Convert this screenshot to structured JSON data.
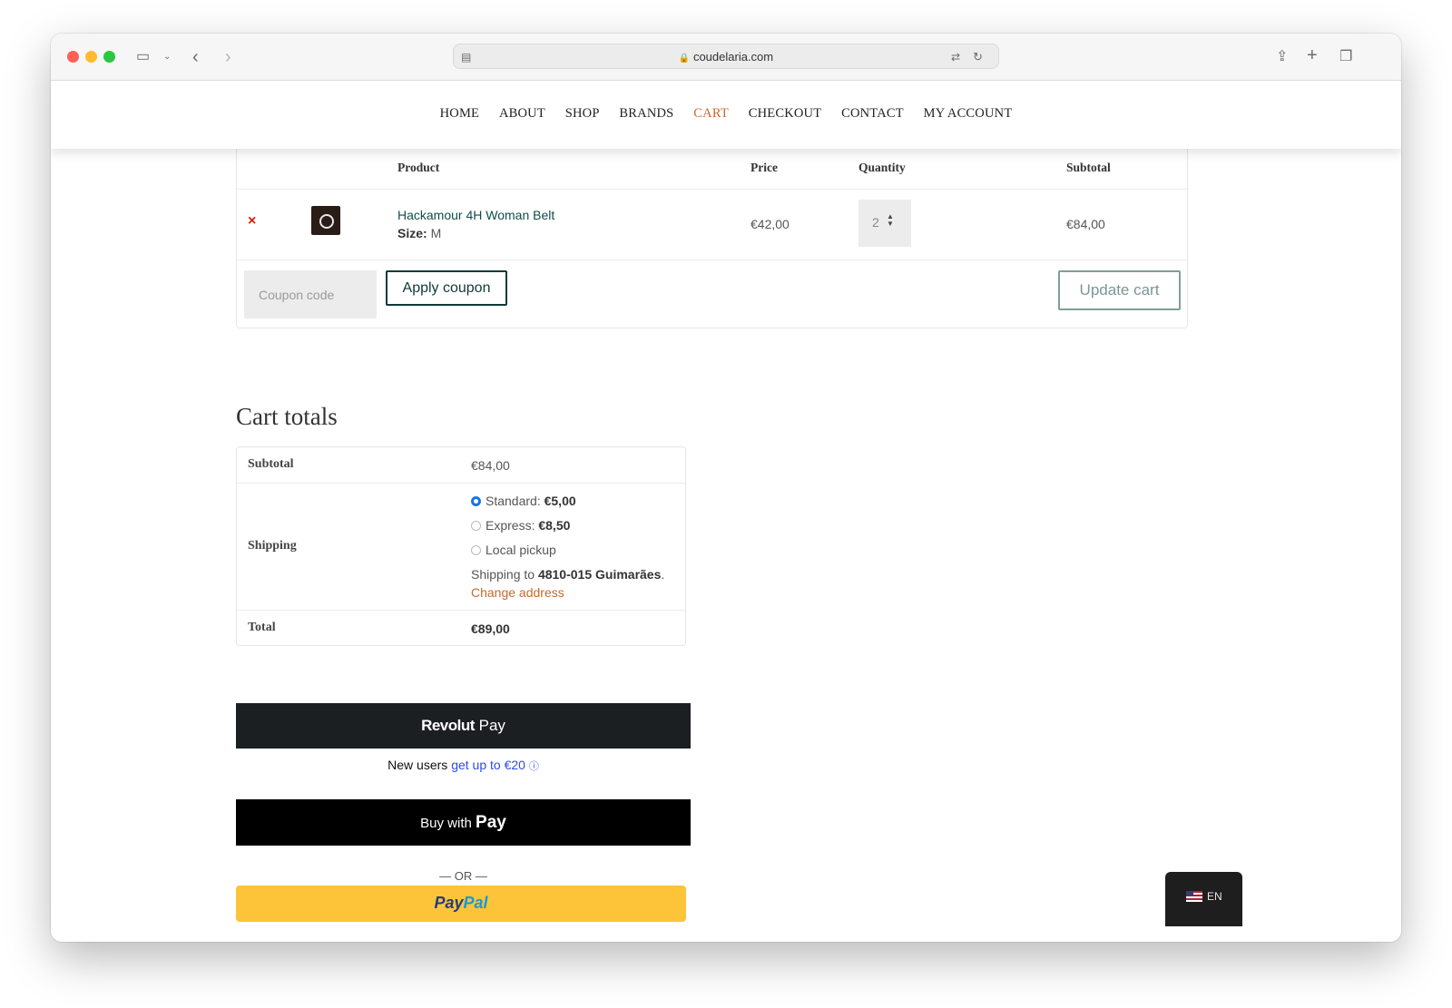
{
  "browser": {
    "url": "coudelaria.com"
  },
  "nav": {
    "items": [
      "HOME",
      "ABOUT",
      "SHOP",
      "BRANDS",
      "CART",
      "CHECKOUT",
      "CONTACT",
      "MY ACCOUNT"
    ],
    "active": "CART"
  },
  "cart": {
    "headers": {
      "product": "Product",
      "price": "Price",
      "quantity": "Quantity",
      "subtotal": "Subtotal"
    },
    "item": {
      "remove_symbol": "×",
      "name": "Hackamour 4H Woman Belt",
      "size_label": "Size:",
      "size_value": "M",
      "price": "€42,00",
      "quantity": "2",
      "subtotal": "€84,00"
    },
    "coupon_placeholder": "Coupon code",
    "apply_coupon_label": "Apply coupon",
    "update_cart_label": "Update cart"
  },
  "totals": {
    "title": "Cart totals",
    "subtotal_label": "Subtotal",
    "subtotal_value": "€84,00",
    "shipping_label": "Shipping",
    "shipping_options": [
      {
        "label": "Standard:",
        "price": "€5,00",
        "selected": true
      },
      {
        "label": "Express:",
        "price": "€8,50",
        "selected": false
      },
      {
        "label": "Local pickup",
        "price": "",
        "selected": false
      }
    ],
    "shipping_to_text": "Shipping to",
    "shipping_destination": "4810-015 Guimarães",
    "change_address_label": "Change address",
    "total_label": "Total",
    "total_value": "€89,00"
  },
  "payments": {
    "revolut_brand": "Revolut",
    "revolut_pay": "Pay",
    "new_users_text": "New users",
    "new_users_link": "get up to €20",
    "apple_pay_prefix": "Buy with",
    "apple_pay_label": "Pay",
    "or_text": "— OR —",
    "paypal_part1": "Pay",
    "paypal_part2": "Pal"
  },
  "language": {
    "code": "EN"
  },
  "colors": {
    "accent": "#c8682c",
    "link": "#0f4d4a",
    "remove": "#e2170b",
    "paypal_bg": "#fdc439"
  }
}
